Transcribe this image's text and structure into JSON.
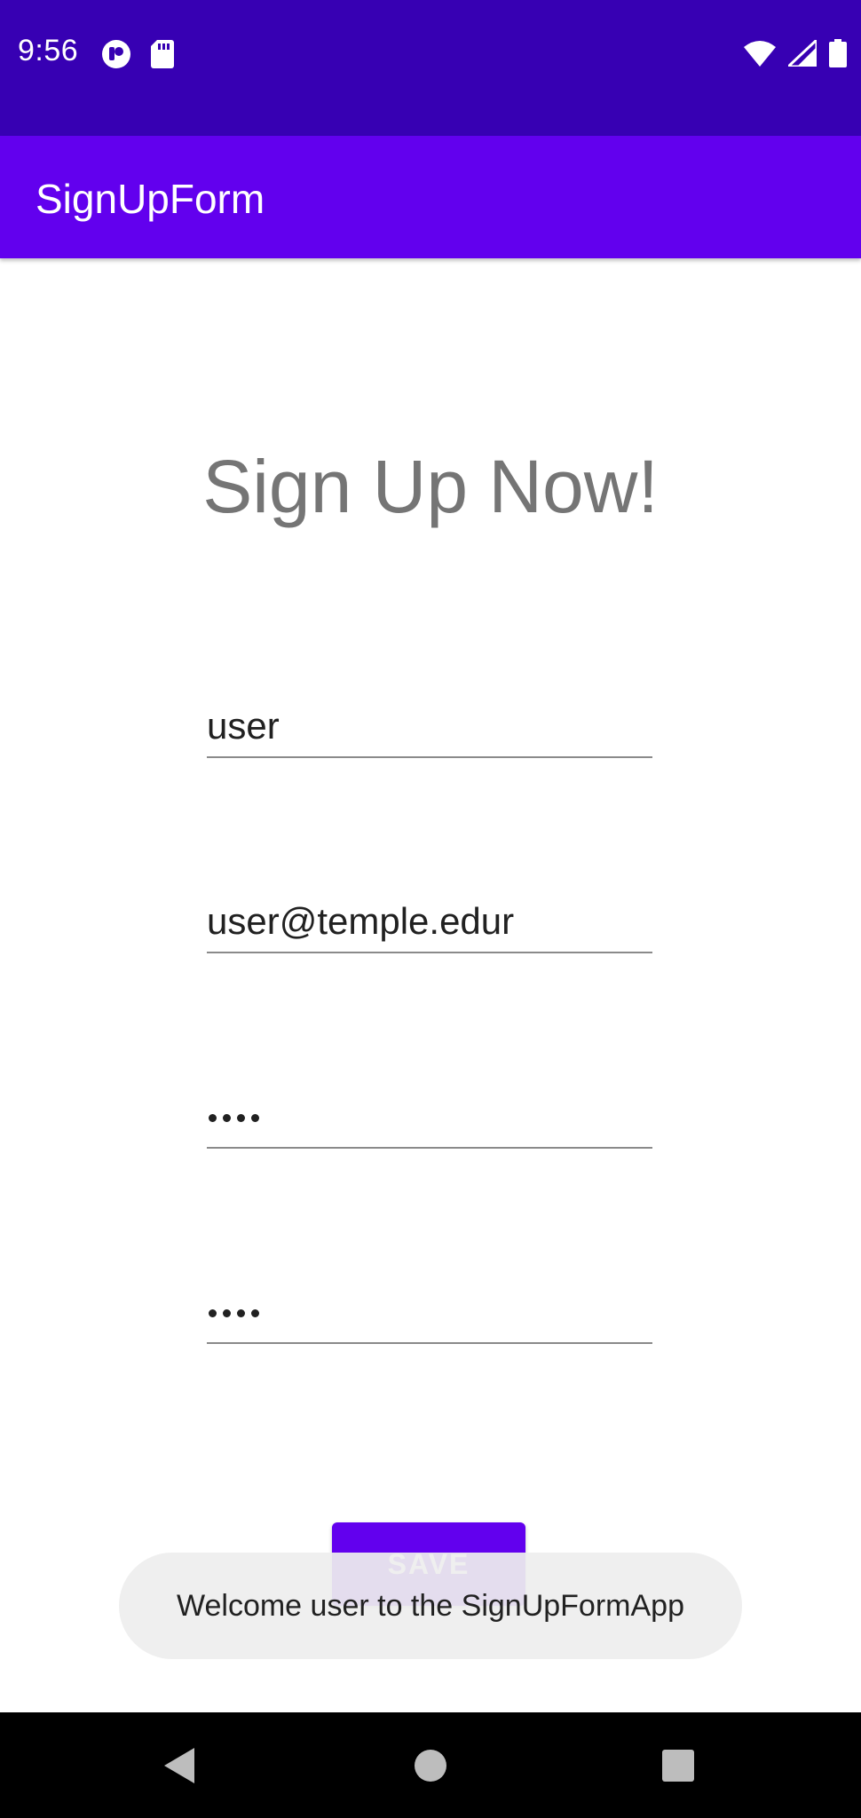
{
  "status_bar": {
    "time": "9:56",
    "left_icons": [
      "notification-app-icon",
      "sd-card-icon"
    ],
    "right_icons": [
      "wifi-icon",
      "cell-signal-icon",
      "battery-icon"
    ],
    "background": "#3700b3"
  },
  "app_bar": {
    "title": "SignUpForm",
    "background": "#6200ee"
  },
  "form": {
    "heading": "Sign Up Now!",
    "name_value": "user",
    "email_value": "user@temple.edur",
    "password_masked": "••••",
    "confirm_password_masked": "••••",
    "save_label": "SAVE"
  },
  "toast": {
    "message": "Welcome user to the SignUpFormApp"
  },
  "nav_bar": {
    "buttons": [
      "back-icon",
      "home-icon",
      "recents-icon"
    ]
  },
  "colors": {
    "accent": "#6200ee",
    "status": "#3700b3",
    "heading_text": "#757575"
  }
}
